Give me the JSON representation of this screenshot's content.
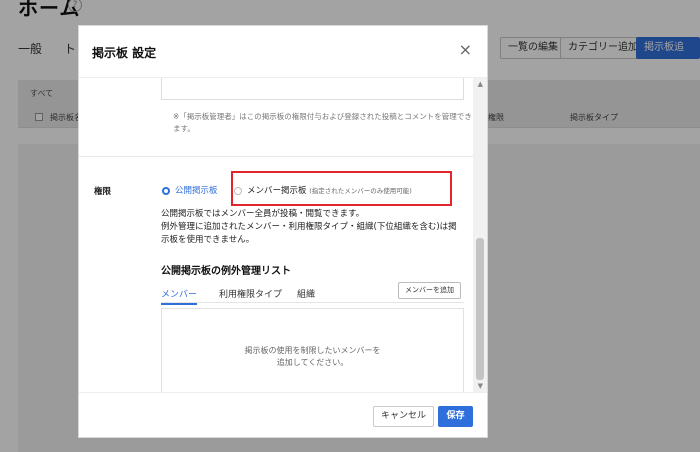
{
  "page": {
    "title": "ホーム",
    "help_icon": "?",
    "tabs": [
      "一般",
      "ト"
    ],
    "toolbar": {
      "edit_list": "一覧の編集",
      "add_category": "カテゴリー追加",
      "add_board": "掲示板追加"
    },
    "table": {
      "all_label": "すべて",
      "col_name": "掲示板名",
      "col_perm": "権限",
      "col_type": "掲示板タイプ"
    }
  },
  "modal": {
    "title": "掲示板 設定",
    "close_icon": "×",
    "note": "※「掲示板管理者」はこの掲示板の権限付与および登録された投稿とコメントを管理できます。",
    "permission": {
      "label": "権限",
      "option_public": "公開掲示板",
      "option_member": "メンバー掲示板",
      "option_member_hint": "(指定されたメンバーのみ使用可能)",
      "selected": "公開掲示板"
    },
    "description": [
      "公開掲示板ではメンバー全員が投稿・閲覧できます。",
      "例外管理に追加されたメンバー・利用権限タイプ・組織(下位組織を含む)は掲示板を使用できません。"
    ],
    "exception": {
      "title": "公開掲示板の例外管理リスト",
      "tabs": [
        "メンバー",
        "利用権限タイプ",
        "組織"
      ],
      "active_tab": "メンバー",
      "add_button": "メンバーを追加",
      "empty_line1": "掲示板の使用を制限したいメンバーを",
      "empty_line2": "追加してください。"
    },
    "footer": {
      "cancel": "キャンセル",
      "save": "保存"
    }
  },
  "colors": {
    "accent": "#2f6fdb",
    "highlight": "#e0262b"
  }
}
